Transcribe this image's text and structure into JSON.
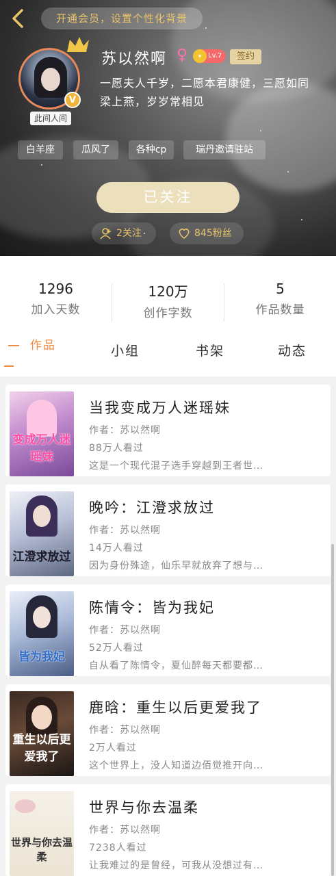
{
  "header": {
    "vip_banner": "开通会员，设置个性化背景",
    "avatar_tag": "此间人间",
    "username": "苏以然啊",
    "gender_symbol": "♀",
    "level": "Lv.7",
    "sign_label": "签约",
    "bio": "一愿夫人千岁，二愿本君康健，三愿如同梁上燕，岁岁常相见",
    "tags": [
      "白羊座",
      "瓜风了",
      "各种cp",
      "瑞丹邀请驻站"
    ],
    "follow_button": "已关注",
    "following": "2关注",
    "fans": "845粉丝"
  },
  "stats": [
    {
      "value": "1296",
      "label": "加入天数"
    },
    {
      "value": "120万",
      "label": "创作字数"
    },
    {
      "value": "5",
      "label": "作品数量"
    }
  ],
  "tabs": [
    "作品",
    "小组",
    "书架",
    "动态"
  ],
  "works": [
    {
      "title": "当我变成万人迷瑶妹",
      "author": "作者：苏以然啊",
      "views": "88万人看过",
      "desc": "这是一个现代混子选手穿越到王者世…",
      "cover_text": "变成万人迷瑶妹"
    },
    {
      "title": "晚吟：江澄求放过",
      "author": "作者：苏以然啊",
      "views": "14万人看过",
      "desc": "因为身份殊途，仙乐早就放弃了想与…",
      "cover_text": "江澄求放过"
    },
    {
      "title": "陈情令：皆为我妃",
      "author": "作者：苏以然啊",
      "views": "52万人看过",
      "desc": "自从看了陈情令，夏仙醉每天都要都…",
      "cover_text": "皆为我妃"
    },
    {
      "title": "鹿晗：重生以后更爱我了",
      "author": "作者：苏以然啊",
      "views": "2万人看过",
      "desc": "这个世界上，没人知道边佰觉推开向…",
      "cover_text": "重生以后更爱我了"
    },
    {
      "title": "世界与你去温柔",
      "author": "作者：苏以然啊",
      "views": "7238人看过",
      "desc": "让我难过的是曾经，可我从没想过有…",
      "cover_text": "世界与你去温柔"
    }
  ]
}
